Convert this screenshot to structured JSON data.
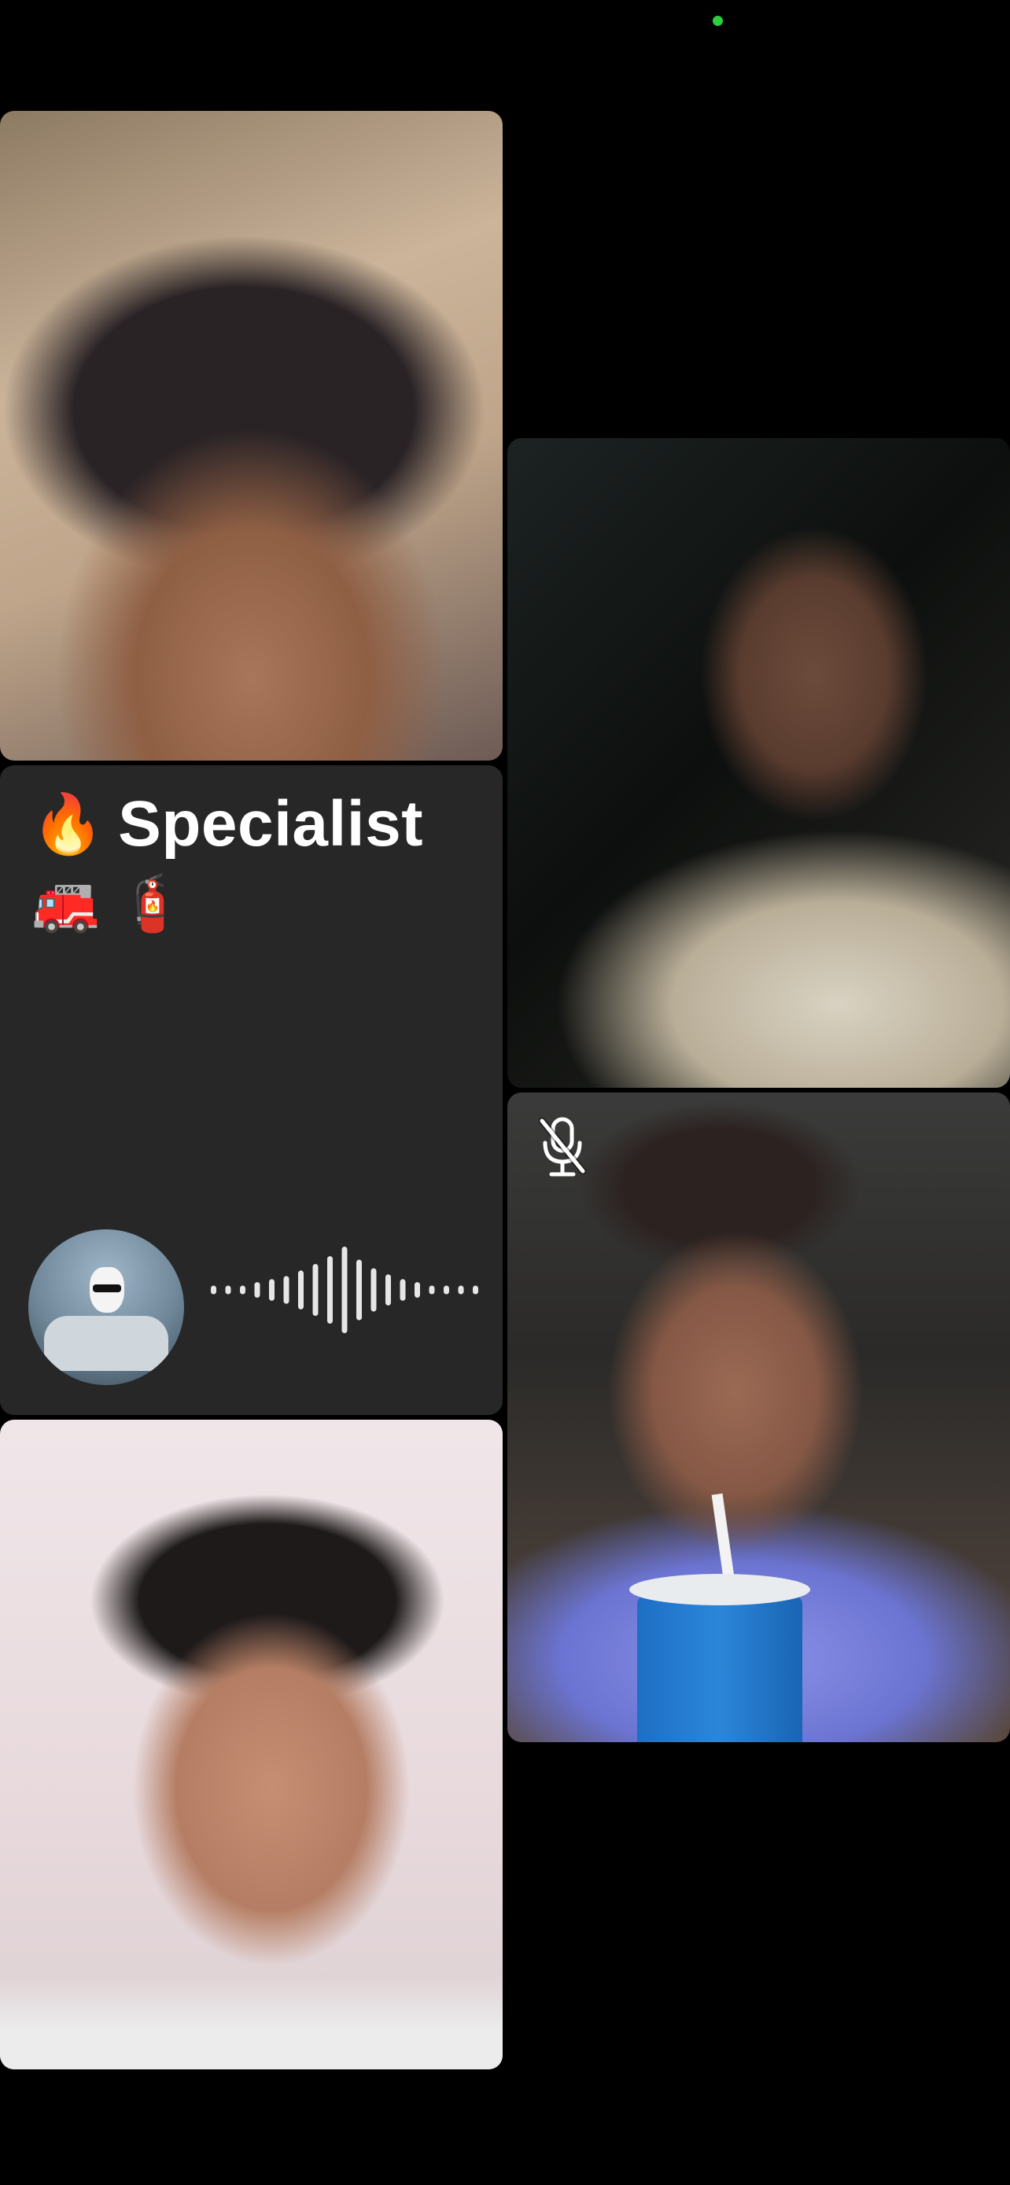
{
  "status_bar": {
    "indicator": "camera-in-use-dot",
    "indicator_color": "#2ecc40"
  },
  "participants": [
    {
      "tile": "top-left",
      "video": "on",
      "muted": false
    },
    {
      "tile": "middle-left",
      "video": "off",
      "muted": false
    },
    {
      "tile": "bottom-left",
      "video": "on",
      "muted": false
    },
    {
      "tile": "middle-right",
      "video": "on",
      "muted": false
    },
    {
      "tile": "bottom-right",
      "video": "on",
      "muted": true
    }
  ],
  "audio_tile": {
    "title_emoji": "🔥",
    "title": "Specialist",
    "emojis": [
      "🚒",
      "🧯"
    ],
    "avatar_icon": "goat-driving-avatar",
    "waveform_icon": "speaking-waveform-icon",
    "waveform_levels": [
      0.1,
      0.1,
      0.1,
      0.18,
      0.25,
      0.32,
      0.45,
      0.6,
      0.78,
      1.0,
      0.7,
      0.5,
      0.36,
      0.25,
      0.18,
      0.1,
      0.1,
      0.1,
      0.1
    ],
    "background": "#272727"
  },
  "icons": {
    "mute": "microphone-slash-icon"
  }
}
